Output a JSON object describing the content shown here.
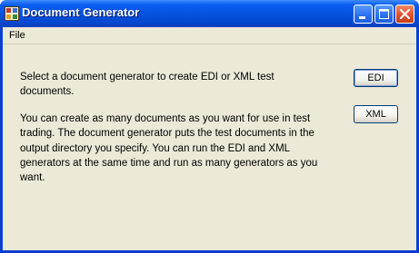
{
  "window": {
    "title": "Document Generator",
    "app_icon": "document-generator-icon",
    "controls": {
      "minimize_icon": "minimize-icon",
      "maximize_icon": "maximize-icon",
      "close_icon": "close-icon"
    }
  },
  "menu": {
    "items": [
      {
        "label": "File"
      }
    ]
  },
  "content": {
    "intro": "Select a document generator to create EDI or XML test documents.",
    "details": "You can create as many documents as you want for use in test trading. The document generator puts the test documents in the output directory you specify. You can run the EDI and XML generators at the same time and run as many generators as you want."
  },
  "buttons": {
    "edi_label": "EDI",
    "xml_label": "XML"
  },
  "colors": {
    "titlebar": "#0552e0",
    "client_background": "#ece9d8",
    "close_button": "#e0502c"
  }
}
